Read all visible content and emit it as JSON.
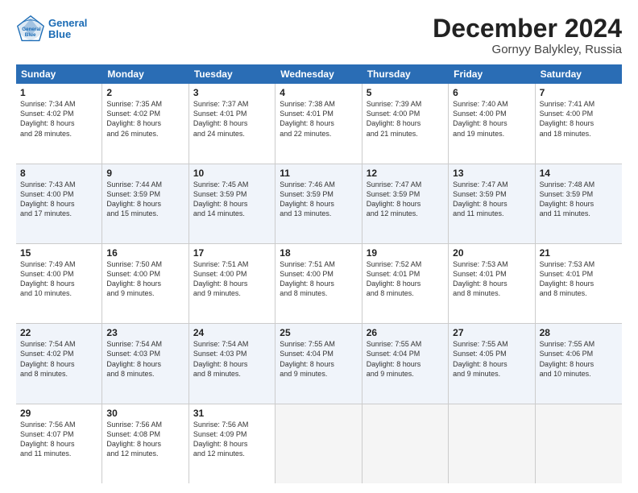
{
  "header": {
    "logo_line1": "General",
    "logo_line2": "Blue",
    "title": "December 2024",
    "subtitle": "Gornyy Balykley, Russia"
  },
  "days": [
    "Sunday",
    "Monday",
    "Tuesday",
    "Wednesday",
    "Thursday",
    "Friday",
    "Saturday"
  ],
  "rows": [
    [
      {
        "day": "1",
        "lines": [
          "Sunrise: 7:34 AM",
          "Sunset: 4:02 PM",
          "Daylight: 8 hours",
          "and 28 minutes."
        ],
        "shade": false
      },
      {
        "day": "2",
        "lines": [
          "Sunrise: 7:35 AM",
          "Sunset: 4:02 PM",
          "Daylight: 8 hours",
          "and 26 minutes."
        ],
        "shade": false
      },
      {
        "day": "3",
        "lines": [
          "Sunrise: 7:37 AM",
          "Sunset: 4:01 PM",
          "Daylight: 8 hours",
          "and 24 minutes."
        ],
        "shade": false
      },
      {
        "day": "4",
        "lines": [
          "Sunrise: 7:38 AM",
          "Sunset: 4:01 PM",
          "Daylight: 8 hours",
          "and 22 minutes."
        ],
        "shade": false
      },
      {
        "day": "5",
        "lines": [
          "Sunrise: 7:39 AM",
          "Sunset: 4:00 PM",
          "Daylight: 8 hours",
          "and 21 minutes."
        ],
        "shade": false
      },
      {
        "day": "6",
        "lines": [
          "Sunrise: 7:40 AM",
          "Sunset: 4:00 PM",
          "Daylight: 8 hours",
          "and 19 minutes."
        ],
        "shade": false
      },
      {
        "day": "7",
        "lines": [
          "Sunrise: 7:41 AM",
          "Sunset: 4:00 PM",
          "Daylight: 8 hours",
          "and 18 minutes."
        ],
        "shade": false
      }
    ],
    [
      {
        "day": "8",
        "lines": [
          "Sunrise: 7:43 AM",
          "Sunset: 4:00 PM",
          "Daylight: 8 hours",
          "and 17 minutes."
        ],
        "shade": true
      },
      {
        "day": "9",
        "lines": [
          "Sunrise: 7:44 AM",
          "Sunset: 3:59 PM",
          "Daylight: 8 hours",
          "and 15 minutes."
        ],
        "shade": true
      },
      {
        "day": "10",
        "lines": [
          "Sunrise: 7:45 AM",
          "Sunset: 3:59 PM",
          "Daylight: 8 hours",
          "and 14 minutes."
        ],
        "shade": true
      },
      {
        "day": "11",
        "lines": [
          "Sunrise: 7:46 AM",
          "Sunset: 3:59 PM",
          "Daylight: 8 hours",
          "and 13 minutes."
        ],
        "shade": true
      },
      {
        "day": "12",
        "lines": [
          "Sunrise: 7:47 AM",
          "Sunset: 3:59 PM",
          "Daylight: 8 hours",
          "and 12 minutes."
        ],
        "shade": true
      },
      {
        "day": "13",
        "lines": [
          "Sunrise: 7:47 AM",
          "Sunset: 3:59 PM",
          "Daylight: 8 hours",
          "and 11 minutes."
        ],
        "shade": true
      },
      {
        "day": "14",
        "lines": [
          "Sunrise: 7:48 AM",
          "Sunset: 3:59 PM",
          "Daylight: 8 hours",
          "and 11 minutes."
        ],
        "shade": true
      }
    ],
    [
      {
        "day": "15",
        "lines": [
          "Sunrise: 7:49 AM",
          "Sunset: 4:00 PM",
          "Daylight: 8 hours",
          "and 10 minutes."
        ],
        "shade": false
      },
      {
        "day": "16",
        "lines": [
          "Sunrise: 7:50 AM",
          "Sunset: 4:00 PM",
          "Daylight: 8 hours",
          "and 9 minutes."
        ],
        "shade": false
      },
      {
        "day": "17",
        "lines": [
          "Sunrise: 7:51 AM",
          "Sunset: 4:00 PM",
          "Daylight: 8 hours",
          "and 9 minutes."
        ],
        "shade": false
      },
      {
        "day": "18",
        "lines": [
          "Sunrise: 7:51 AM",
          "Sunset: 4:00 PM",
          "Daylight: 8 hours",
          "and 8 minutes."
        ],
        "shade": false
      },
      {
        "day": "19",
        "lines": [
          "Sunrise: 7:52 AM",
          "Sunset: 4:01 PM",
          "Daylight: 8 hours",
          "and 8 minutes."
        ],
        "shade": false
      },
      {
        "day": "20",
        "lines": [
          "Sunrise: 7:53 AM",
          "Sunset: 4:01 PM",
          "Daylight: 8 hours",
          "and 8 minutes."
        ],
        "shade": false
      },
      {
        "day": "21",
        "lines": [
          "Sunrise: 7:53 AM",
          "Sunset: 4:01 PM",
          "Daylight: 8 hours",
          "and 8 minutes."
        ],
        "shade": false
      }
    ],
    [
      {
        "day": "22",
        "lines": [
          "Sunrise: 7:54 AM",
          "Sunset: 4:02 PM",
          "Daylight: 8 hours",
          "and 8 minutes."
        ],
        "shade": true
      },
      {
        "day": "23",
        "lines": [
          "Sunrise: 7:54 AM",
          "Sunset: 4:03 PM",
          "Daylight: 8 hours",
          "and 8 minutes."
        ],
        "shade": true
      },
      {
        "day": "24",
        "lines": [
          "Sunrise: 7:54 AM",
          "Sunset: 4:03 PM",
          "Daylight: 8 hours",
          "and 8 minutes."
        ],
        "shade": true
      },
      {
        "day": "25",
        "lines": [
          "Sunrise: 7:55 AM",
          "Sunset: 4:04 PM",
          "Daylight: 8 hours",
          "and 9 minutes."
        ],
        "shade": true
      },
      {
        "day": "26",
        "lines": [
          "Sunrise: 7:55 AM",
          "Sunset: 4:04 PM",
          "Daylight: 8 hours",
          "and 9 minutes."
        ],
        "shade": true
      },
      {
        "day": "27",
        "lines": [
          "Sunrise: 7:55 AM",
          "Sunset: 4:05 PM",
          "Daylight: 8 hours",
          "and 9 minutes."
        ],
        "shade": true
      },
      {
        "day": "28",
        "lines": [
          "Sunrise: 7:55 AM",
          "Sunset: 4:06 PM",
          "Daylight: 8 hours",
          "and 10 minutes."
        ],
        "shade": true
      }
    ],
    [
      {
        "day": "29",
        "lines": [
          "Sunrise: 7:56 AM",
          "Sunset: 4:07 PM",
          "Daylight: 8 hours",
          "and 11 minutes."
        ],
        "shade": false
      },
      {
        "day": "30",
        "lines": [
          "Sunrise: 7:56 AM",
          "Sunset: 4:08 PM",
          "Daylight: 8 hours",
          "and 12 minutes."
        ],
        "shade": false
      },
      {
        "day": "31",
        "lines": [
          "Sunrise: 7:56 AM",
          "Sunset: 4:09 PM",
          "Daylight: 8 hours",
          "and 12 minutes."
        ],
        "shade": false
      },
      {
        "day": "",
        "lines": [],
        "shade": false,
        "empty": true
      },
      {
        "day": "",
        "lines": [],
        "shade": false,
        "empty": true
      },
      {
        "day": "",
        "lines": [],
        "shade": false,
        "empty": true
      },
      {
        "day": "",
        "lines": [],
        "shade": false,
        "empty": true
      }
    ]
  ]
}
